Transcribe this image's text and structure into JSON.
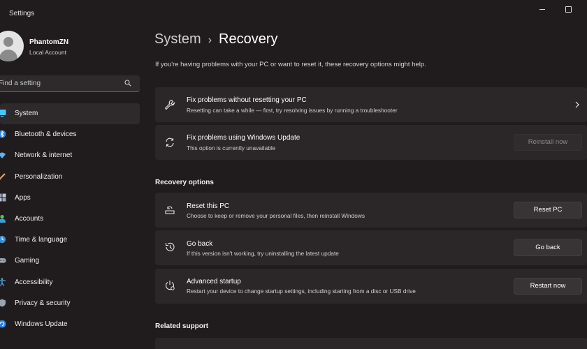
{
  "window": {
    "title": "Settings"
  },
  "profile": {
    "name": "PhantomZN",
    "account_type": "Local Account"
  },
  "search": {
    "placeholder": "Find a setting"
  },
  "sidebar": {
    "items": [
      {
        "label": "System",
        "icon": "monitor-icon",
        "active": true
      },
      {
        "label": "Bluetooth & devices",
        "icon": "bluetooth-icon"
      },
      {
        "label": "Network & internet",
        "icon": "wifi-icon"
      },
      {
        "label": "Personalization",
        "icon": "brush-icon"
      },
      {
        "label": "Apps",
        "icon": "apps-icon"
      },
      {
        "label": "Accounts",
        "icon": "person-icon"
      },
      {
        "label": "Time & language",
        "icon": "globe-clock-icon"
      },
      {
        "label": "Gaming",
        "icon": "gamepad-icon"
      },
      {
        "label": "Accessibility",
        "icon": "accessibility-icon"
      },
      {
        "label": "Privacy & security",
        "icon": "shield-icon"
      },
      {
        "label": "Windows Update",
        "icon": "update-icon"
      }
    ]
  },
  "breadcrumb": {
    "parent": "System",
    "separator": "›",
    "current": "Recovery"
  },
  "description": "If you're having problems with your PC or want to reset it, these recovery options might help.",
  "cards": {
    "fix_no_reset": {
      "title": "Fix problems without resetting your PC",
      "subtitle": "Resetting can take a while — first, try resolving issues by running a troubleshooter"
    },
    "fix_windows_update": {
      "title": "Fix problems using Windows Update",
      "subtitle": "This option is currently unavailable",
      "button": "Reinstall now"
    }
  },
  "recovery_options": {
    "heading": "Recovery options",
    "items": [
      {
        "title": "Reset this PC",
        "subtitle": "Choose to keep or remove your personal files, then reinstall Windows",
        "button": "Reset PC"
      },
      {
        "title": "Go back",
        "subtitle": "If this version isn't working, try uninstalling the latest update",
        "button": "Go back"
      },
      {
        "title": "Advanced startup",
        "subtitle": "Restart your device to change startup settings, including starting from a disc or USB drive",
        "button": "Restart now"
      }
    ]
  },
  "related": {
    "heading": "Related support"
  },
  "colors": {
    "background": "#201c1d",
    "card": "#2b2728",
    "accent": "#4cc2ff"
  }
}
